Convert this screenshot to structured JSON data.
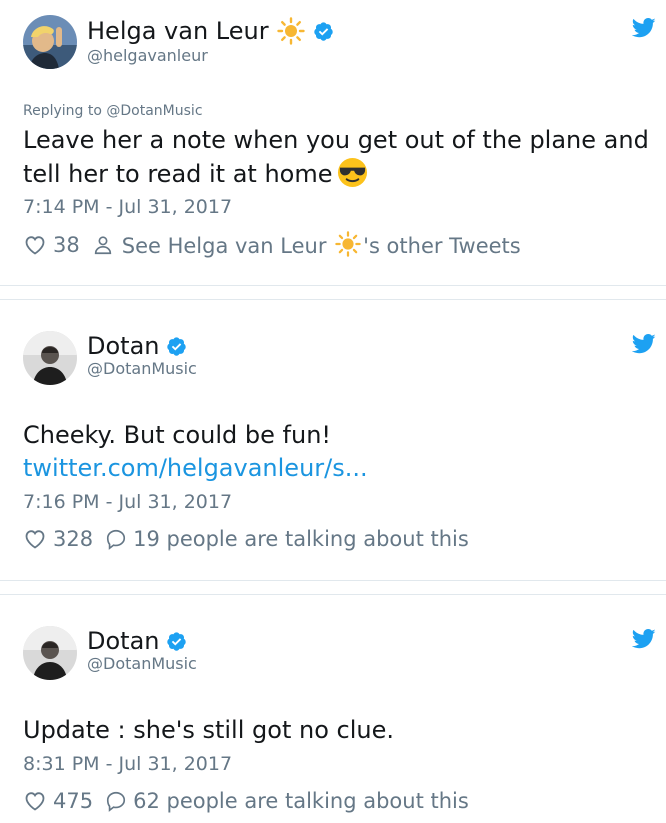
{
  "tweets": [
    {
      "name": "Helga van Leur",
      "handle": "@helgavanleur",
      "replying_prefix": "Replying to",
      "replying_to": "@DotanMusic",
      "text_line1": "Leave her a note when you get out of the plane and",
      "text_line2": "tell her to read it at home",
      "time": "7:14 PM - Jul 31, 2017",
      "likes": "38",
      "other_prefix": "See Helga van Leur",
      "other_suffix": "'s other Tweets"
    },
    {
      "name": "Dotan",
      "handle": "@DotanMusic",
      "text_line1": "Cheeky. But could be fun!",
      "link": "twitter.com/helgavanleur/s...",
      "time": "7:16 PM - Jul 31, 2017",
      "likes": "328",
      "talking": "19 people are talking about this"
    },
    {
      "name": "Dotan",
      "handle": "@DotanMusic",
      "text_line1": "Update : she's still got no clue.",
      "time": "8:31 PM - Jul 31, 2017",
      "likes": "475",
      "talking": "62 people are talking about this"
    }
  ],
  "colors": {
    "twitter_blue": "#1da1f2",
    "link": "#1b95e0",
    "muted": "#657786",
    "text": "#14171a",
    "sun": "#f4b400"
  },
  "icons": [
    "heart-icon",
    "person-icon",
    "speech-bubble-icon",
    "twitter-bird-icon",
    "verified-badge-icon",
    "sun-emoji-icon",
    "sunglasses-emoji-icon"
  ]
}
